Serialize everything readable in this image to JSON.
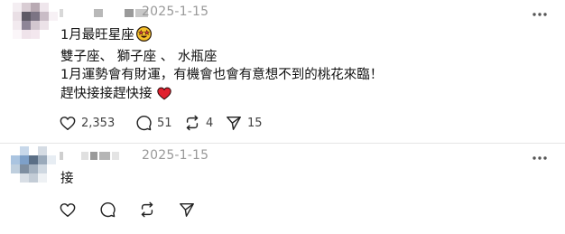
{
  "posts": [
    {
      "timestamp": "2025-1-15",
      "lines": [
        "1月最旺星座",
        "雙子座、 獅子座 、 水瓶座",
        "1月運勢會有財運，有機會也會有意想不到的桃花來臨！",
        "趕快接接趕快接"
      ],
      "line_emojis": [
        "star-struck-emoji",
        null,
        null,
        "red-heart-emoji"
      ],
      "stats": {
        "likes": "2,353",
        "comments": "51",
        "reposts": "4",
        "shares": "15"
      }
    },
    {
      "timestamp": "2025-1-15",
      "lines": [
        "接"
      ],
      "stats": {
        "likes": "",
        "comments": "",
        "reposts": "",
        "shares": ""
      }
    }
  ],
  "icons": {
    "more": "more-horizontal-icon",
    "like": "heart-outline-icon",
    "comment": "comment-bubble-icon",
    "repost": "repost-arrows-icon",
    "share": "send-paper-plane-icon"
  },
  "colors": {
    "text": "#111111",
    "muted": "#999999",
    "action": "#424242",
    "heart_emoji": "#e0202e",
    "divider": "#e6e6e6"
  }
}
